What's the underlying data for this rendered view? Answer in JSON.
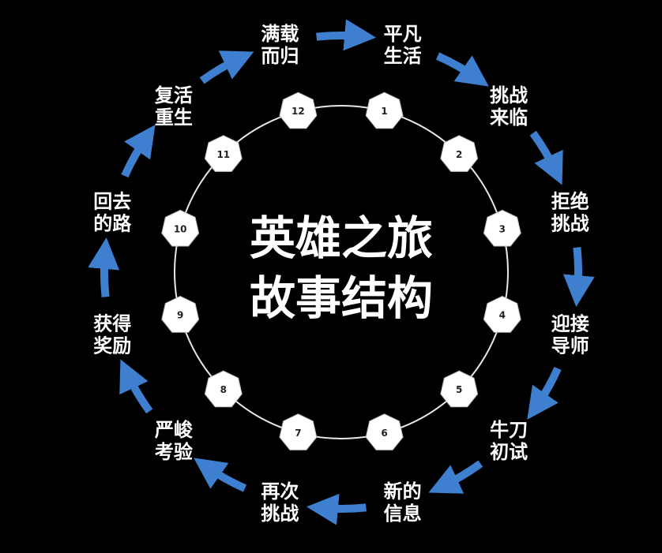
{
  "title_line1": "英雄之旅",
  "title_line2": "故事结构",
  "stages": [
    {
      "number": "1",
      "line1": "平凡",
      "line2": "生活"
    },
    {
      "number": "2",
      "line1": "挑战",
      "line2": "来临"
    },
    {
      "number": "3",
      "line1": "拒绝",
      "line2": "挑战"
    },
    {
      "number": "4",
      "line1": "迎接",
      "line2": "导师"
    },
    {
      "number": "5",
      "line1": "牛刀",
      "line2": "初试"
    },
    {
      "number": "6",
      "line1": "新的",
      "line2": "信息"
    },
    {
      "number": "7",
      "line1": "再次",
      "line2": "挑战"
    },
    {
      "number": "8",
      "line1": "严峻",
      "line2": "考验"
    },
    {
      "number": "9",
      "line1": "获得",
      "line2": "奖励"
    },
    {
      "number": "10",
      "line1": "回去",
      "line2": "的路"
    },
    {
      "number": "11",
      "line1": "复活",
      "line2": "重生"
    },
    {
      "number": "12",
      "line1": "满载",
      "line2": "而归"
    }
  ],
  "colors": {
    "background": "#000000",
    "ring": "#e8e8e8",
    "node": "#ffffff",
    "arrow": "#3f7fd0",
    "text": "#ffffff"
  }
}
